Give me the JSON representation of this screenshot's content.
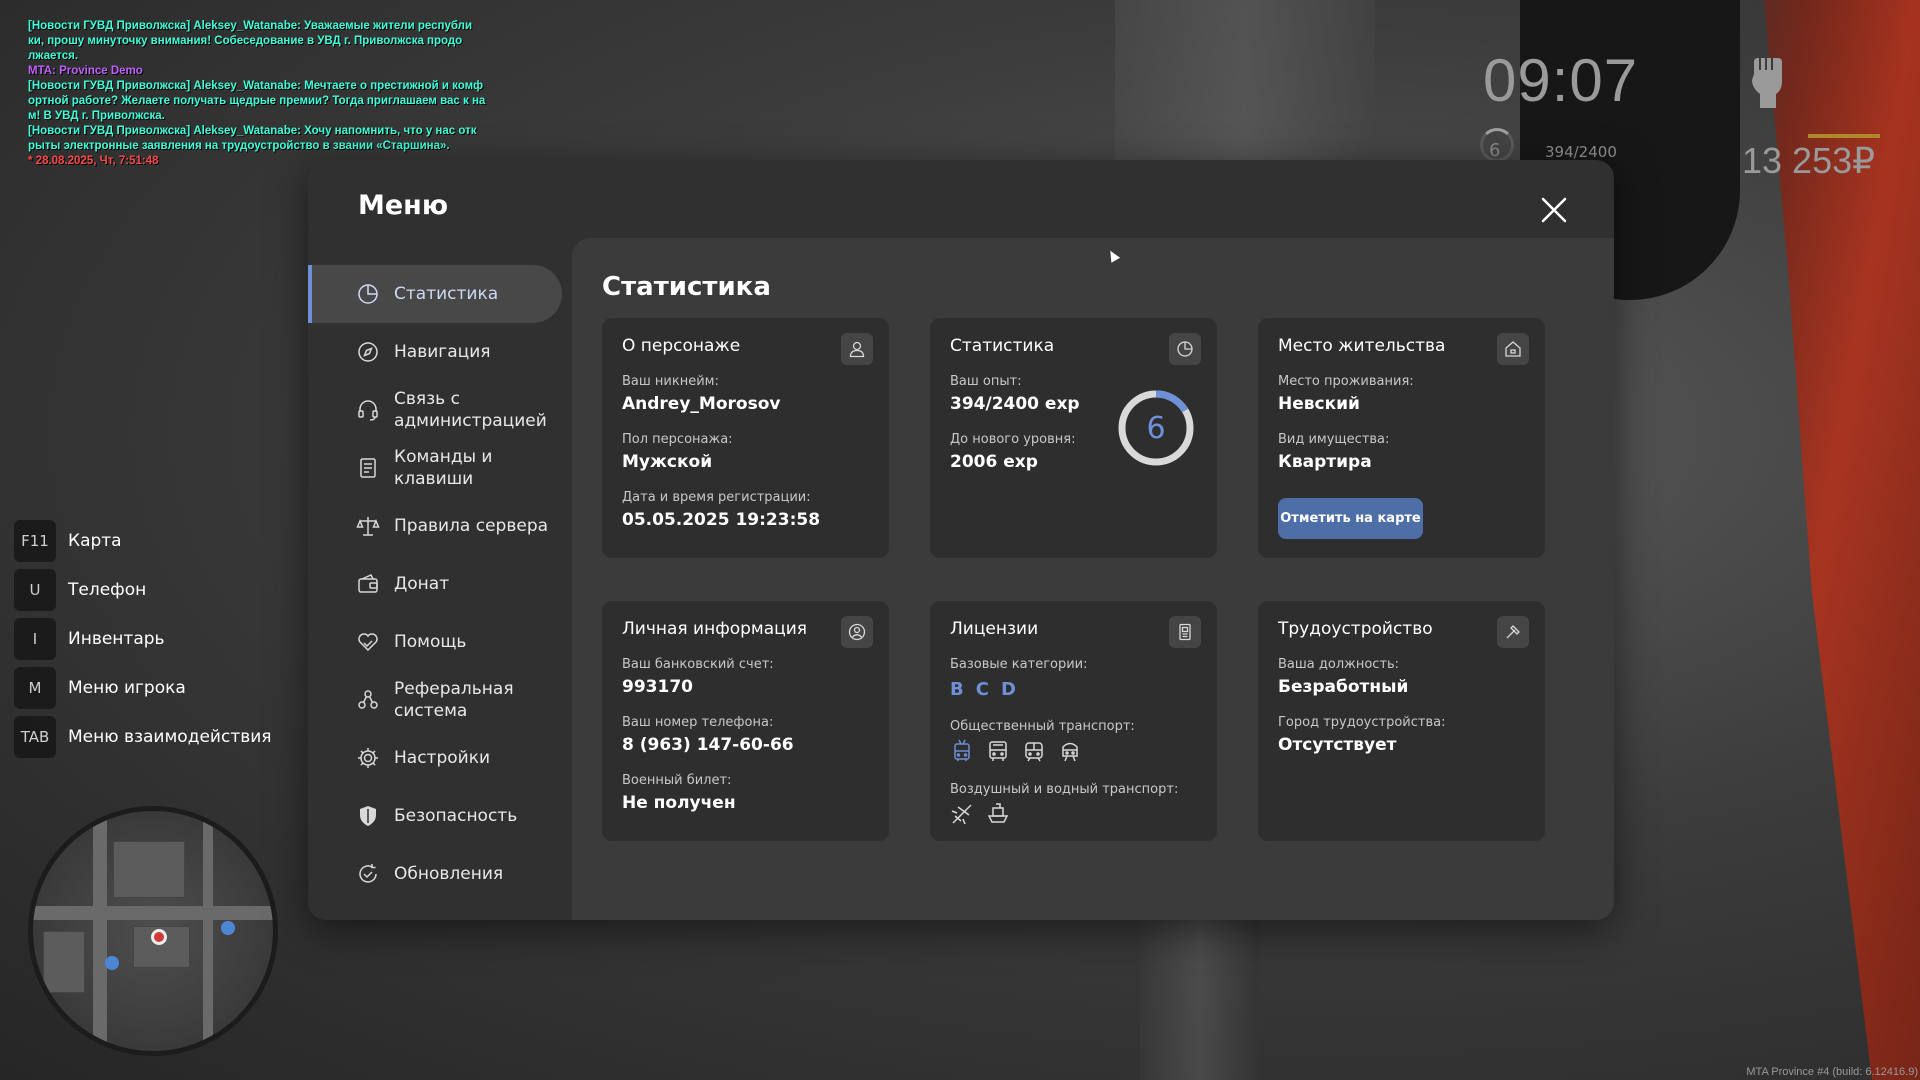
{
  "chat": {
    "lines": [
      {
        "text": "[Новости ГУВД Приволжска] Aleksey_Watanabe: Уважаемые жители республи",
        "kind": "news"
      },
      {
        "text": "ки, прошу минуточку внимания! Собеседование в УВД г. Приволжска продо",
        "kind": "news"
      },
      {
        "text": "лжается.",
        "kind": "news"
      },
      {
        "text": "MTA: Province Demo",
        "kind": "mta"
      },
      {
        "text": "[Новости ГУВД Приволжска] Aleksey_Watanabe: Мечтаете о престижной и комф",
        "kind": "news"
      },
      {
        "text": "ортной работе? Желаете получать щедрые премии? Тогда приглашаем вас к на",
        "kind": "news"
      },
      {
        "text": "м! В УВД г. Приволжска.",
        "kind": "news"
      },
      {
        "text": "[Новости ГУВД Приволжска] Aleksey_Watanabe: Хочу напомнить, что у нас отк",
        "kind": "news"
      },
      {
        "text": "рыты электронные заявления на трудоустройство в звании «Старшина».",
        "kind": "news"
      },
      {
        "text": "* 28.08.2025, Чт, 7:51:48",
        "kind": "date"
      }
    ]
  },
  "hud": {
    "time": "09:07",
    "level": "6",
    "exp": "394/2400",
    "money": "13 253₽"
  },
  "keybinds": [
    {
      "key": "F11",
      "label": "Карта"
    },
    {
      "key": "U",
      "label": "Телефон"
    },
    {
      "key": "I",
      "label": "Инвентарь"
    },
    {
      "key": "M",
      "label": "Меню игрока"
    },
    {
      "key": "TAB",
      "label": "Меню взаимодействия"
    }
  ],
  "menu": {
    "title": "Меню",
    "nav": [
      {
        "label": "Статистика",
        "icon": "pie-chart-icon",
        "active": true
      },
      {
        "label": "Навигация",
        "icon": "compass-icon"
      },
      {
        "label": "Связь с администрацией",
        "line1": "Связь с",
        "line2": "администрацией",
        "icon": "headset-icon"
      },
      {
        "label": "Команды и клавиши",
        "line1": "Команды и",
        "line2": "клавиши",
        "icon": "document-icon"
      },
      {
        "label": "Правила сервера",
        "icon": "scales-icon"
      },
      {
        "label": "Донат",
        "icon": "wallet-icon"
      },
      {
        "label": "Помощь",
        "icon": "heart-hand-icon"
      },
      {
        "label": "Реферальная система",
        "line1": "Реферальная",
        "line2": "система",
        "icon": "people-icon"
      },
      {
        "label": "Настройки",
        "icon": "gear-icon"
      },
      {
        "label": "Безопасность",
        "icon": "shield-icon"
      },
      {
        "label": "Обновления",
        "icon": "refresh-check-icon"
      }
    ]
  },
  "stats": {
    "title": "Статистика",
    "character": {
      "title": "О персонаже",
      "icon": "user-icon",
      "nickname_label": "Ваш никнейм:",
      "nickname": "Andrey_Morosov",
      "gender_label": "Пол персонажа:",
      "gender": "Мужской",
      "reg_label": "Дата и время регистрации:",
      "reg": "05.05.2025 19:23:58"
    },
    "statistics": {
      "title": "Статистика",
      "icon": "pie-chart-icon",
      "exp_label": "Ваш опыт:",
      "exp": "394/2400 exp",
      "next_label": "До нового уровня:",
      "next": "2006 exp",
      "level": "6",
      "progress": 0.164
    },
    "residence": {
      "title": "Место жительства",
      "icon": "home-icon",
      "place_label": "Место проживания:",
      "place": "Невский",
      "type_label": "Вид имущества:",
      "type": "Квартира",
      "button": "Отметить на карте"
    },
    "personal": {
      "title": "Личная информация",
      "icon": "user-circle-icon",
      "bank_label": "Ваш банковский счет:",
      "bank": "993170",
      "phone_label": "Ваш номер телефона:",
      "phone": "8 (963) 147-60-66",
      "military_label": "Военный билет:",
      "military": "Не получен"
    },
    "licenses": {
      "title": "Лицензии",
      "icon": "id-card-icon",
      "base_label": "Базовые категории:",
      "base": [
        "B",
        "C",
        "D"
      ],
      "public_label": "Общественный транспорт:",
      "public_icons": [
        "trolleybus-icon",
        "bus-icon",
        "tram-icon",
        "train-icon"
      ],
      "air_label": "Воздушный и водный транспорт:",
      "air_icons": [
        "plane-icon",
        "ship-icon"
      ]
    },
    "job": {
      "title": "Трудоустройство",
      "icon": "hammer-icon",
      "position_label": "Ваша должность:",
      "position": "Безработный",
      "city_label": "Город трудоустройства:",
      "city": "Отсутствует"
    }
  },
  "footer": "MTA Province #4 (build: 6.12416.9)",
  "colors": {
    "accent": "#6f8fd6",
    "button": "#4e6ea8",
    "chat_news": "#40ffd9",
    "chat_mta": "#c060ff",
    "chat_date": "#ff4848"
  }
}
